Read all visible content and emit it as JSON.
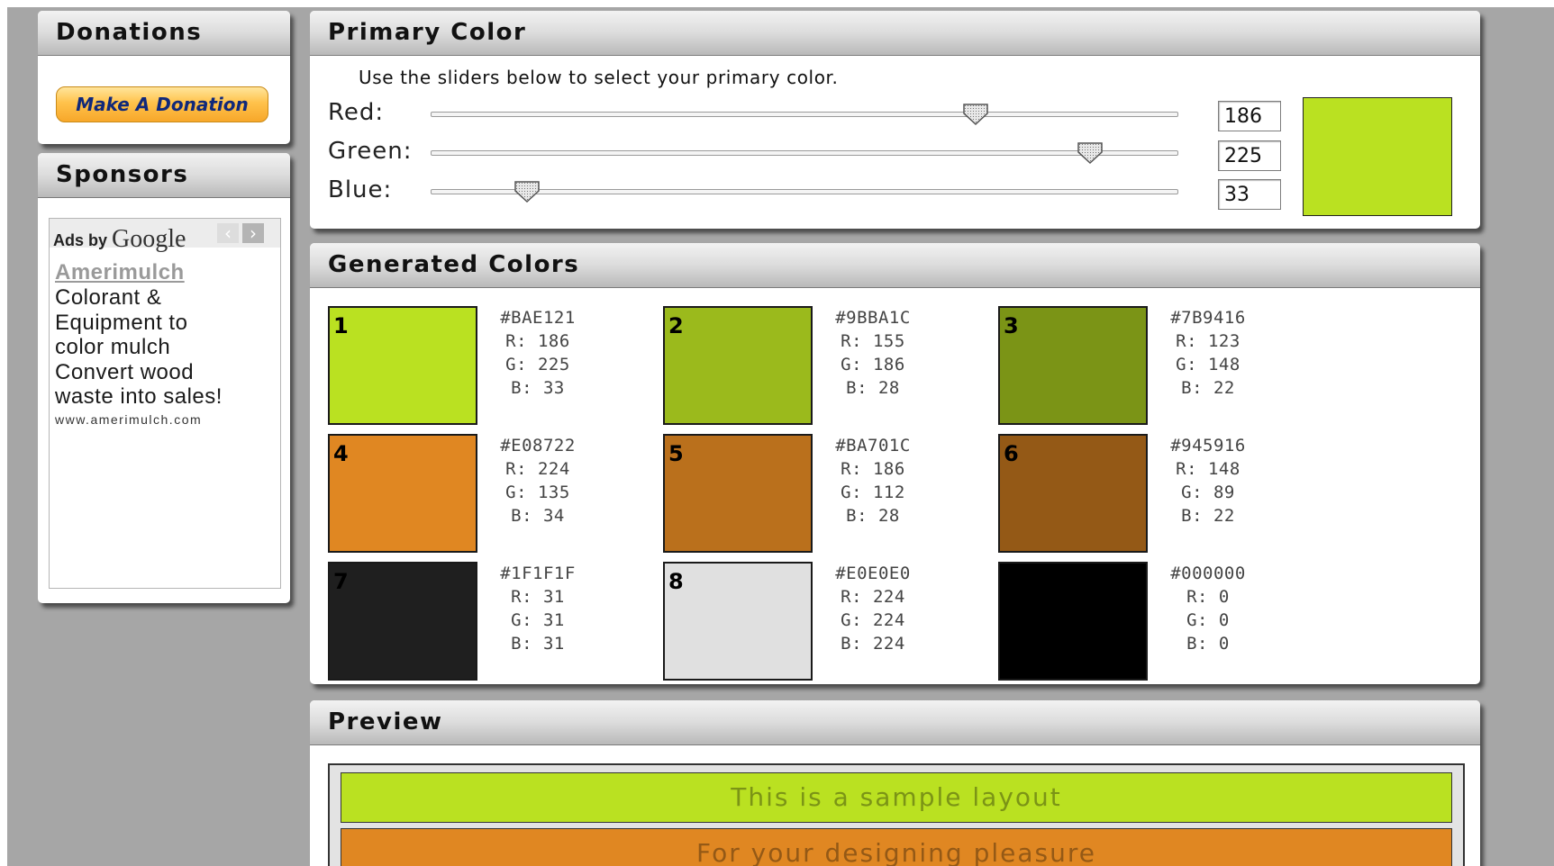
{
  "donations": {
    "title": "Donations",
    "button_label": "Make A Donation"
  },
  "sponsors": {
    "title": "Sponsors",
    "ads_by": "Ads by",
    "google": "Google",
    "prev": "‹",
    "next": "›",
    "ad_title": "Amerimulch",
    "ad_lines": [
      "Colorant &",
      "Equipment to",
      "color mulch",
      "Convert wood",
      "waste into sales!"
    ],
    "ad_url": "www.amerimulch.com"
  },
  "primary": {
    "title": "Primary Color",
    "instructions": "Use the sliders below to select your primary color.",
    "red_label": "Red:",
    "green_label": "Green:",
    "blue_label": "Blue:",
    "red_value": "186",
    "green_value": "225",
    "blue_value": "33",
    "slider_max": 255,
    "swatch_color": "#BAE121"
  },
  "generated": {
    "title": "Generated Colors",
    "colors": [
      {
        "num": "1",
        "hex": "#BAE121",
        "r": "R: 186",
        "g": "G: 225",
        "b": "B: 33",
        "fill": "#BAE121"
      },
      {
        "num": "2",
        "hex": "#9BBA1C",
        "r": "R: 155",
        "g": "G: 186",
        "b": "B: 28",
        "fill": "#9BBA1C"
      },
      {
        "num": "3",
        "hex": "#7B9416",
        "r": "R: 123",
        "g": "G: 148",
        "b": "B: 22",
        "fill": "#7B9416"
      },
      {
        "num": "4",
        "hex": "#E08722",
        "r": "R: 224",
        "g": "G: 135",
        "b": "B: 34",
        "fill": "#E08722"
      },
      {
        "num": "5",
        "hex": "#BA701C",
        "r": "R: 186",
        "g": "G: 112",
        "b": "B: 28",
        "fill": "#BA701C"
      },
      {
        "num": "6",
        "hex": "#945916",
        "r": "R: 148",
        "g": "G: 89",
        "b": "B: 22",
        "fill": "#945916"
      },
      {
        "num": "7",
        "hex": "#1F1F1F",
        "r": "R: 31",
        "g": "G: 31",
        "b": "B: 31",
        "fill": "#1F1F1F"
      },
      {
        "num": "8",
        "hex": "#E0E0E0",
        "r": "R: 224",
        "g": "G: 224",
        "b": "B: 224",
        "fill": "#E0E0E0"
      },
      {
        "num": "",
        "hex": "#000000",
        "r": "R: 0",
        "g": "G: 0",
        "b": "B: 0",
        "fill": "#000000"
      }
    ]
  },
  "preview": {
    "title": "Preview",
    "line1": "This is a sample layout",
    "line2": "For your designing pleasure",
    "line1_bg": "#BAE121",
    "line1_color": "#7B9416",
    "line2_bg": "#E08722",
    "line2_color": "#945916"
  }
}
